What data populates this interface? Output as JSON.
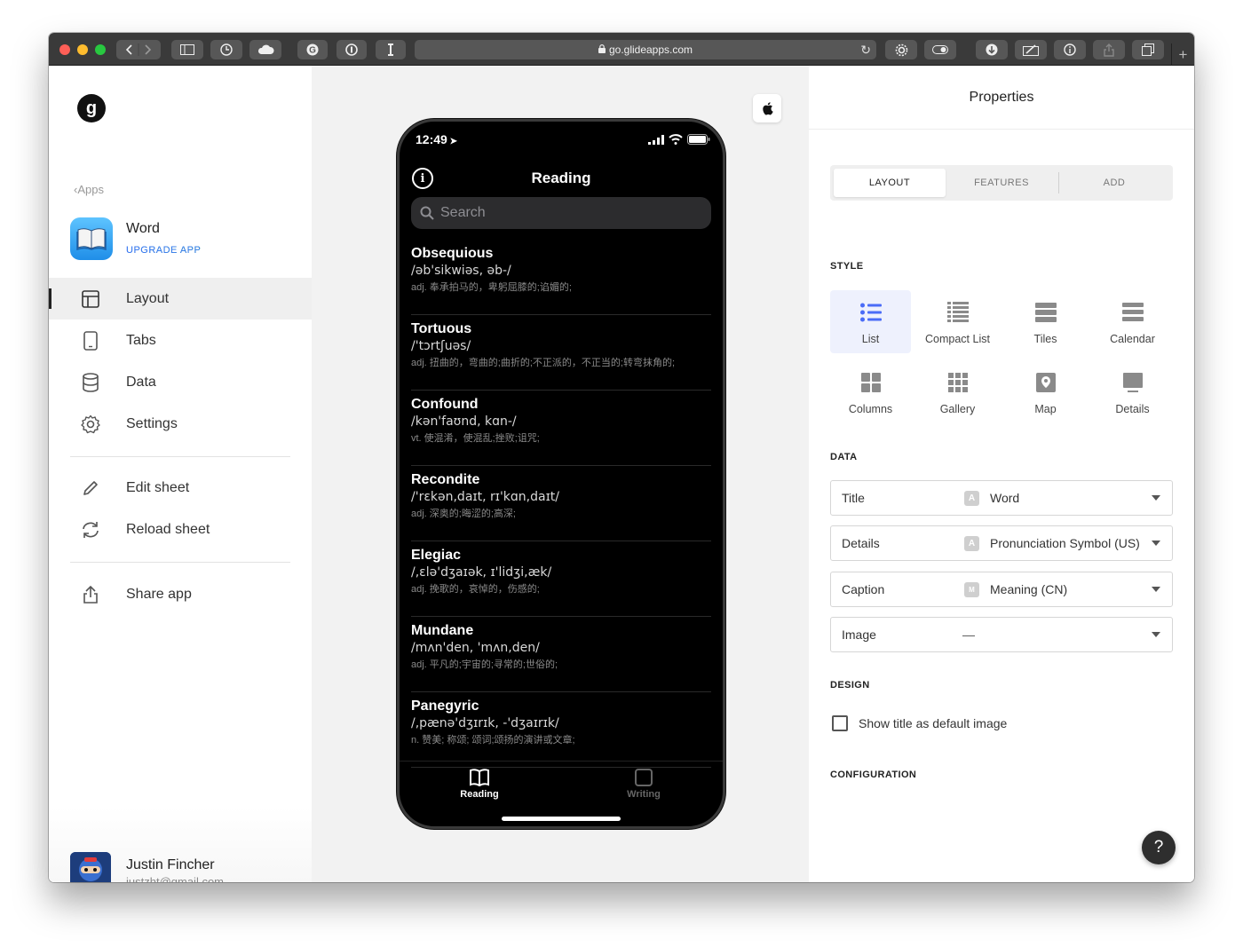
{
  "browser": {
    "url": "go.glideapps.com",
    "new_tab": "+"
  },
  "sidebar": {
    "logo": "g",
    "apps_link": "Apps",
    "app_name": "Word",
    "upgrade_label": "UPGRADE APP",
    "nav": [
      {
        "label": "Layout",
        "icon": "layout-icon",
        "active": true
      },
      {
        "label": "Tabs",
        "icon": "phone-icon"
      },
      {
        "label": "Data",
        "icon": "database-icon"
      },
      {
        "label": "Settings",
        "icon": "gear-icon"
      }
    ],
    "actions": [
      {
        "label": "Edit sheet",
        "icon": "pencil-icon"
      },
      {
        "label": "Reload sheet",
        "icon": "refresh-icon"
      }
    ],
    "share": {
      "label": "Share app",
      "icon": "share-icon"
    },
    "user": {
      "name": "Justin Fincher",
      "email": "justzht@gmail.com"
    }
  },
  "phone": {
    "time": "12:49",
    "title": "Reading",
    "search_placeholder": "Search",
    "words": [
      {
        "title": "Obsequious",
        "pron": "/əb'sikwiəs, əb-/",
        "meaning": "adj. 奉承拍马的，卑躬屈膝的;谄媚的;"
      },
      {
        "title": "Tortuous",
        "pron": "/'tɔrtʃuəs/",
        "meaning": "adj. 扭曲的，弯曲的;曲折的;不正派的，不正当的;转弯抹角的;"
      },
      {
        "title": "Confound",
        "pron": "/kən'faʊnd, kɑn-/",
        "meaning": "vt. 使混淆，使混乱;挫败;诅咒;"
      },
      {
        "title": "Recondite",
        "pron": "/'rɛkən,daɪt, rɪ'kɑn,daɪt/",
        "meaning": "adj. 深奥的;晦涩的;高深;"
      },
      {
        "title": "Elegiac",
        "pron": "/,ɛlə'dʒaɪək, ɪ'lidʒi,æk/",
        "meaning": "adj. 挽歌的，哀悼的，伤感的;"
      },
      {
        "title": "Mundane",
        "pron": "/mʌn'den, 'mʌn,den/",
        "meaning": "adj. 平凡的;宇宙的;寻常的;世俗的;"
      },
      {
        "title": "Panegyric",
        "pron": "/,pænə'dʒɪrɪk, -'dʒaɪrɪk/",
        "meaning": "n. 赞美; 称颂; 颂词;颂扬的演讲或文章;"
      }
    ],
    "tabs": [
      {
        "label": "Reading",
        "icon": "book-icon",
        "active": true
      },
      {
        "label": "Writing",
        "icon": "square-icon",
        "active": false
      }
    ]
  },
  "properties": {
    "title": "Properties",
    "tabs": [
      "LAYOUT",
      "FEATURES",
      "ADD"
    ],
    "active_tab": "LAYOUT",
    "sections": {
      "style": "STYLE",
      "data": "DATA",
      "design": "DESIGN",
      "configuration": "CONFIGURATION"
    },
    "styles": [
      {
        "label": "List",
        "icon": "list-icon",
        "active": true
      },
      {
        "label": "Compact List",
        "icon": "compact-list-icon"
      },
      {
        "label": "Tiles",
        "icon": "tiles-icon"
      },
      {
        "label": "Calendar",
        "icon": "calendar-icon"
      },
      {
        "label": "Columns",
        "icon": "columns-icon"
      },
      {
        "label": "Gallery",
        "icon": "gallery-icon"
      },
      {
        "label": "Map",
        "icon": "map-icon"
      },
      {
        "label": "Details",
        "icon": "details-icon"
      }
    ],
    "fields": [
      {
        "label": "Title",
        "badge": "A",
        "value": "Word"
      },
      {
        "label": "Details",
        "badge": "A",
        "value": "Pronunciation Symbol (US)"
      },
      {
        "label": "Caption",
        "badge": "M",
        "value": "Meaning (CN)"
      },
      {
        "label": "Image",
        "badge": "",
        "value": "—"
      }
    ],
    "show_title_default": "Show title as default image",
    "show_title_checked": false,
    "help": "?"
  },
  "colors": {
    "accent": "#4a6cf7",
    "upgrade_green": "#22c55e"
  }
}
